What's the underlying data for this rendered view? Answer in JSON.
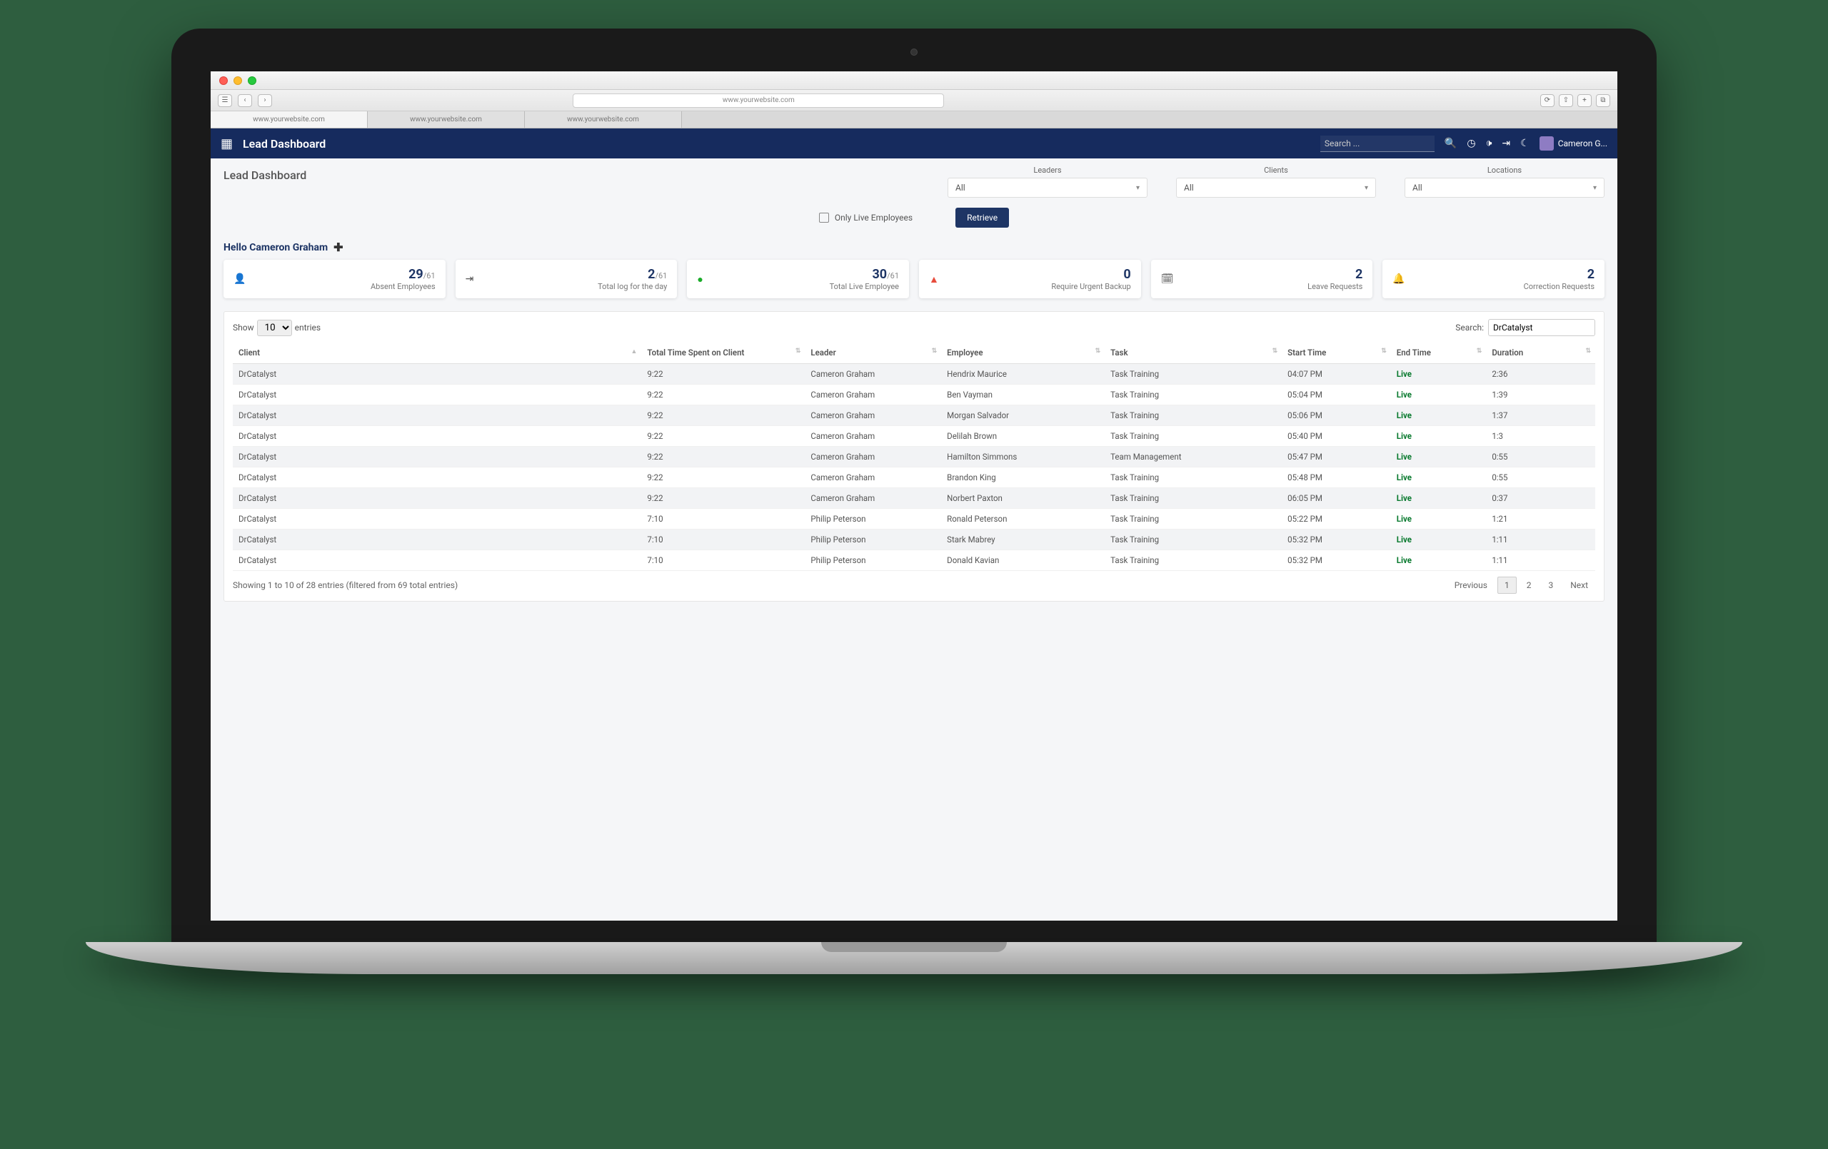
{
  "browser": {
    "url": "www.yourwebsite.com",
    "tabs": [
      "www.yourwebsite.com",
      "www.yourwebsite.com",
      "www.yourwebsite.com"
    ]
  },
  "nav": {
    "title": "Lead Dashboard",
    "search_placeholder": "Search ...",
    "user_name": "Cameron G..."
  },
  "page": {
    "title": "Lead Dashboard",
    "hello": "Hello Cameron Graham"
  },
  "filters": {
    "leaders_label": "Leaders",
    "leaders_value": "All",
    "clients_label": "Clients",
    "clients_value": "All",
    "locations_label": "Locations",
    "locations_value": "All",
    "only_live_label": "Only Live Employees",
    "retrieve_label": "Retrieve"
  },
  "cards": [
    {
      "num": "29",
      "sub": "/61",
      "label": "Absent Employees"
    },
    {
      "num": "2",
      "sub": "/61",
      "label": "Total log for the day"
    },
    {
      "num": "30",
      "sub": "/61",
      "label": "Total Live Employee"
    },
    {
      "num": "0",
      "sub": "",
      "label": "Require Urgent Backup"
    },
    {
      "num": "2",
      "sub": "",
      "label": "Leave Requests"
    },
    {
      "num": "2",
      "sub": "",
      "label": "Correction Requests"
    }
  ],
  "table": {
    "show_label": "Show",
    "entries_val": "10",
    "entries_label": "entries",
    "search_label": "Search:",
    "search_value": "DrCatalyst",
    "columns": [
      "Client",
      "Total Time Spent on Client",
      "Leader",
      "Employee",
      "Task",
      "Start Time",
      "End Time",
      "Duration"
    ],
    "rows": [
      {
        "client": "DrCatalyst",
        "total": "9:22",
        "leader": "Cameron Graham",
        "employee": "Hendrix Maurice",
        "task": "Task Training",
        "start": "04:07 PM",
        "end": "Live",
        "dur": "2:36"
      },
      {
        "client": "DrCatalyst",
        "total": "9:22",
        "leader": "Cameron Graham",
        "employee": "Ben Vayman",
        "task": "Task Training",
        "start": "05:04 PM",
        "end": "Live",
        "dur": "1:39"
      },
      {
        "client": "DrCatalyst",
        "total": "9:22",
        "leader": "Cameron Graham",
        "employee": "Morgan Salvador",
        "task": "Task Training",
        "start": "05:06 PM",
        "end": "Live",
        "dur": "1:37"
      },
      {
        "client": "DrCatalyst",
        "total": "9:22",
        "leader": "Cameron Graham",
        "employee": "Delilah Brown",
        "task": "Task Training",
        "start": "05:40 PM",
        "end": "Live",
        "dur": "1:3"
      },
      {
        "client": "DrCatalyst",
        "total": "9:22",
        "leader": "Cameron Graham",
        "employee": "Hamilton Simmons",
        "task": "Team Management",
        "start": "05:47 PM",
        "end": "Live",
        "dur": "0:55"
      },
      {
        "client": "DrCatalyst",
        "total": "9:22",
        "leader": "Cameron Graham",
        "employee": "Brandon King",
        "task": "Task Training",
        "start": "05:48 PM",
        "end": "Live",
        "dur": "0:55"
      },
      {
        "client": "DrCatalyst",
        "total": "9:22",
        "leader": "Cameron Graham",
        "employee": "Norbert Paxton",
        "task": "Task Training",
        "start": "06:05 PM",
        "end": "Live",
        "dur": "0:37"
      },
      {
        "client": "DrCatalyst",
        "total": "7:10",
        "leader": "Philip Peterson",
        "employee": "Ronald Peterson",
        "task": "Task Training",
        "start": "05:22 PM",
        "end": "Live",
        "dur": "1:21"
      },
      {
        "client": "DrCatalyst",
        "total": "7:10",
        "leader": "Philip Peterson",
        "employee": "Stark Mabrey",
        "task": "Task Training",
        "start": "05:32 PM",
        "end": "Live",
        "dur": "1:11"
      },
      {
        "client": "DrCatalyst",
        "total": "7:10",
        "leader": "Philip Peterson",
        "employee": "Donald Kavian",
        "task": "Task Training",
        "start": "05:32 PM",
        "end": "Live",
        "dur": "1:11"
      }
    ],
    "info": "Showing 1 to 10 of 28 entries (filtered from 69 total entries)",
    "pager": {
      "prev": "Previous",
      "pages": [
        "1",
        "2",
        "3"
      ],
      "next": "Next"
    }
  }
}
